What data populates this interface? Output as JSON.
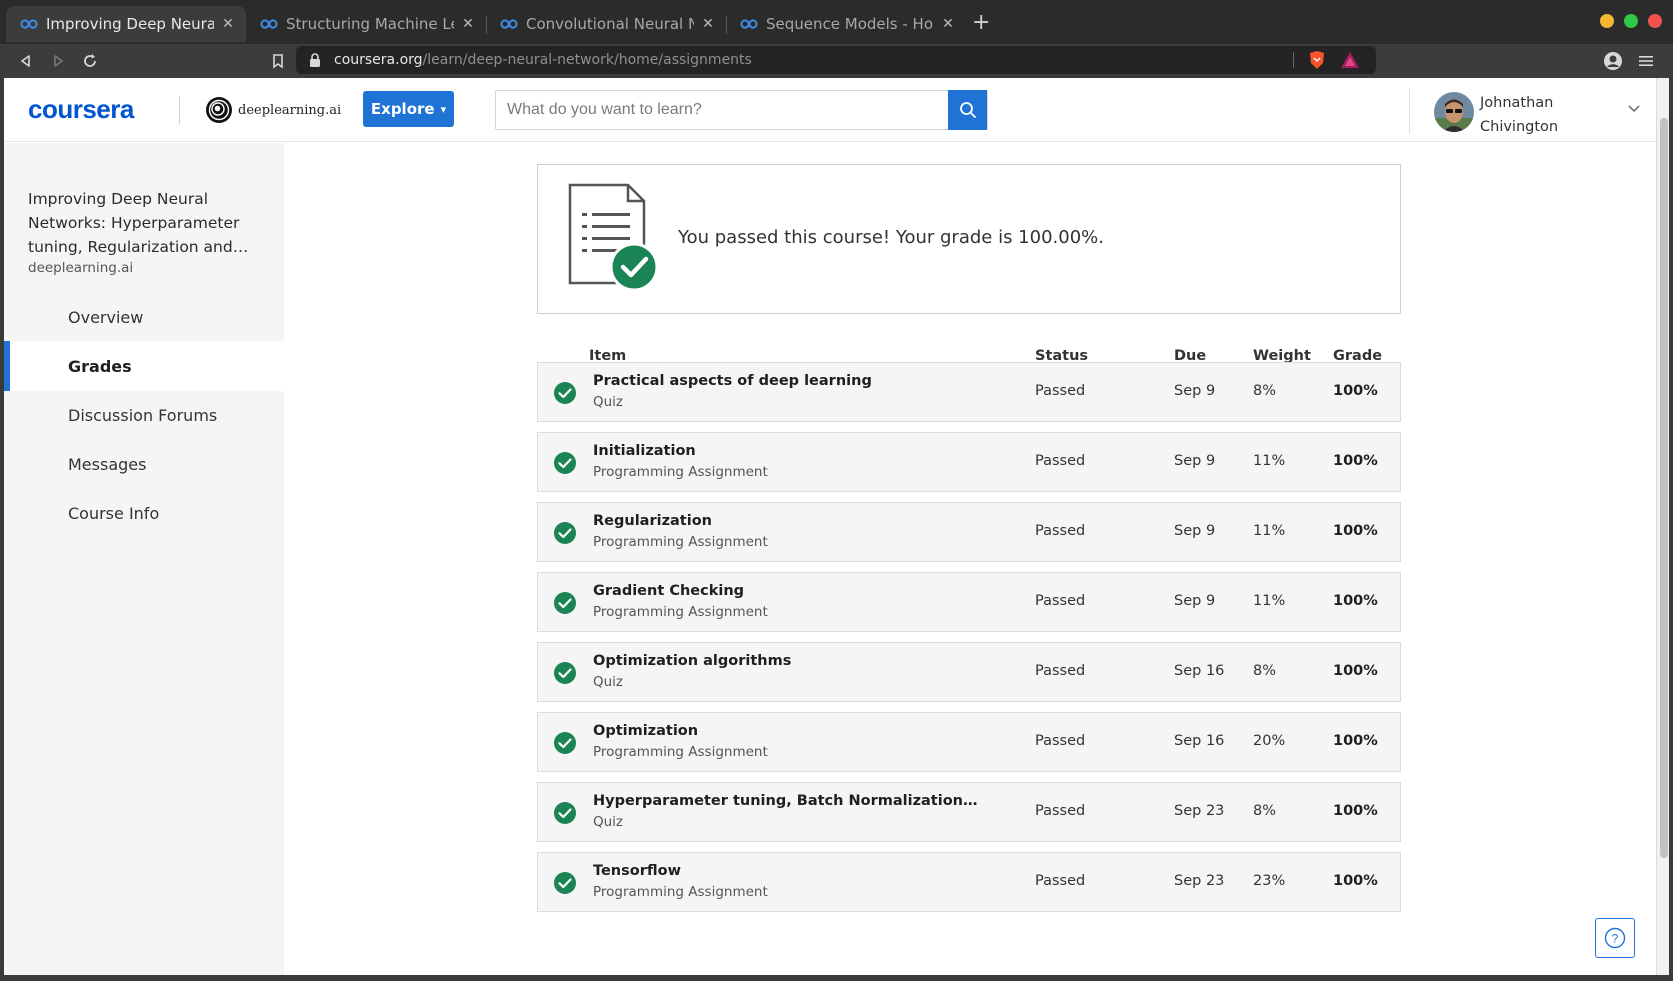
{
  "browser": {
    "tabs": [
      {
        "title": "Improving Deep Neural Networks",
        "active": true
      },
      {
        "title": "Structuring Machine Learning",
        "active": false
      },
      {
        "title": "Convolutional Neural Networks",
        "active": false
      },
      {
        "title": "Sequence Models - Home |",
        "active": false
      }
    ],
    "url_host": "coursera.org",
    "url_path": "/learn/deep-neural-network/home/assignments"
  },
  "header": {
    "logo": "coursera",
    "partner": "deeplearning.ai",
    "explore_label": "Explore",
    "search_placeholder": "What do you want to learn?",
    "user_first": "Johnathan",
    "user_last": "Chivington"
  },
  "sidebar": {
    "course_title": "Improving Deep Neural Networks: Hyperparameter tuning, Regularization and…",
    "course_partner": "deeplearning.ai",
    "items": [
      {
        "label": "Overview",
        "active": false
      },
      {
        "label": "Grades",
        "active": true
      },
      {
        "label": "Discussion Forums",
        "active": false
      },
      {
        "label": "Messages",
        "active": false
      },
      {
        "label": "Course Info",
        "active": false
      }
    ]
  },
  "banner": {
    "message": "You passed this course! Your grade is 100.00%."
  },
  "table": {
    "headers": {
      "item": "Item",
      "status": "Status",
      "due": "Due",
      "weight": "Weight",
      "grade": "Grade"
    },
    "rows": [
      {
        "name": "Practical aspects of deep learning",
        "type": "Quiz",
        "status": "Passed",
        "due": "Sep 9",
        "weight": "8%",
        "grade": "100%"
      },
      {
        "name": "Initialization",
        "type": "Programming Assignment",
        "status": "Passed",
        "due": "Sep 9",
        "weight": "11%",
        "grade": "100%"
      },
      {
        "name": "Regularization",
        "type": "Programming Assignment",
        "status": "Passed",
        "due": "Sep 9",
        "weight": "11%",
        "grade": "100%"
      },
      {
        "name": "Gradient Checking",
        "type": "Programming Assignment",
        "status": "Passed",
        "due": "Sep 9",
        "weight": "11%",
        "grade": "100%"
      },
      {
        "name": "Optimization algorithms",
        "type": "Quiz",
        "status": "Passed",
        "due": "Sep 16",
        "weight": "8%",
        "grade": "100%"
      },
      {
        "name": "Optimization",
        "type": "Programming Assignment",
        "status": "Passed",
        "due": "Sep 16",
        "weight": "20%",
        "grade": "100%"
      },
      {
        "name": "Hyperparameter tuning, Batch Normalization, Progra...",
        "type": "Quiz",
        "status": "Passed",
        "due": "Sep 23",
        "weight": "8%",
        "grade": "100%"
      },
      {
        "name": "Tensorflow",
        "type": "Programming Assignment",
        "status": "Passed",
        "due": "Sep 23",
        "weight": "23%",
        "grade": "100%"
      }
    ]
  },
  "help_label": "?",
  "colors": {
    "accent": "#1f73d4",
    "success": "#1a8454",
    "brand": "#0056d2"
  }
}
